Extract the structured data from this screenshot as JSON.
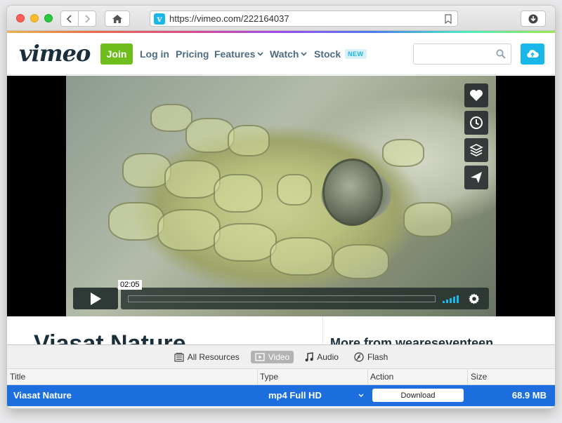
{
  "browser": {
    "url": "https://vimeo.com/222164037",
    "favicon_letter": "v"
  },
  "vimeo_header": {
    "logo": "vimeo",
    "join_label": "Join",
    "nav": [
      {
        "label": "Log in"
      },
      {
        "label": "Pricing"
      },
      {
        "label": "Features"
      },
      {
        "label": "Watch"
      },
      {
        "label": "Stock"
      }
    ],
    "new_badge": "NEW",
    "search_placeholder": ""
  },
  "player": {
    "time_badge": "02:05",
    "side_actions": [
      "heart-icon",
      "clock-icon",
      "layers-icon",
      "send-icon"
    ],
    "progress": 0
  },
  "page": {
    "video_title": "Viasat Nature",
    "more_title": "More from weareseventeen"
  },
  "panel": {
    "filters": [
      {
        "label": "All Resources",
        "icon": "resources-icon",
        "active": false
      },
      {
        "label": "Video",
        "icon": "video-icon",
        "active": true
      },
      {
        "label": "Audio",
        "icon": "music-note-icon",
        "active": false
      },
      {
        "label": "Flash",
        "icon": "flash-icon",
        "active": false
      }
    ],
    "columns": [
      "Title",
      "Type",
      "Action",
      "Size"
    ],
    "rows": [
      {
        "title": "Viasat Nature",
        "type": "mp4 Full HD",
        "action": "Download",
        "size": "68.9 MB"
      }
    ]
  },
  "colors": {
    "vimeo_blue": "#1ab7ea",
    "join_green": "#6fbe1e",
    "selection_blue": "#1d6fe0"
  }
}
